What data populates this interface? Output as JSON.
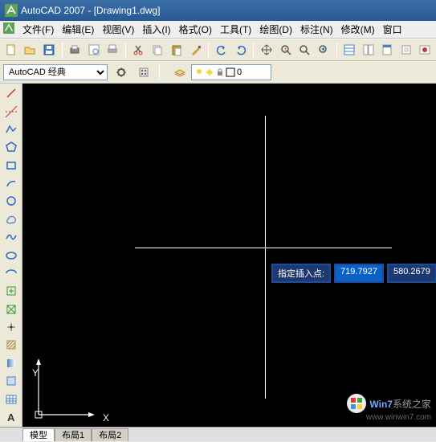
{
  "title": "AutoCAD 2007 - [Drawing1.dwg]",
  "menus": {
    "file": "文件(F)",
    "edit": "编辑(E)",
    "view": "视图(V)",
    "insert": "插入(I)",
    "format": "格式(O)",
    "tools": "工具(T)",
    "draw": "绘图(D)",
    "label": "标注(N)",
    "modify": "修改(M)",
    "window": "窗口"
  },
  "workspace": {
    "selected": "AutoCAD 经典"
  },
  "layer": {
    "current": "0"
  },
  "prompt": {
    "text": "指定插入点:",
    "x": "719.7927",
    "y": "580.2679"
  },
  "ucs": {
    "x": "X",
    "y": "Y"
  },
  "tabs": {
    "model": "模型",
    "layout1": "布局1",
    "layout2": "布局2"
  },
  "watermark": {
    "line1a": "Win7",
    "line1b": "系统之家",
    "line2": "www.winwin7.com"
  }
}
